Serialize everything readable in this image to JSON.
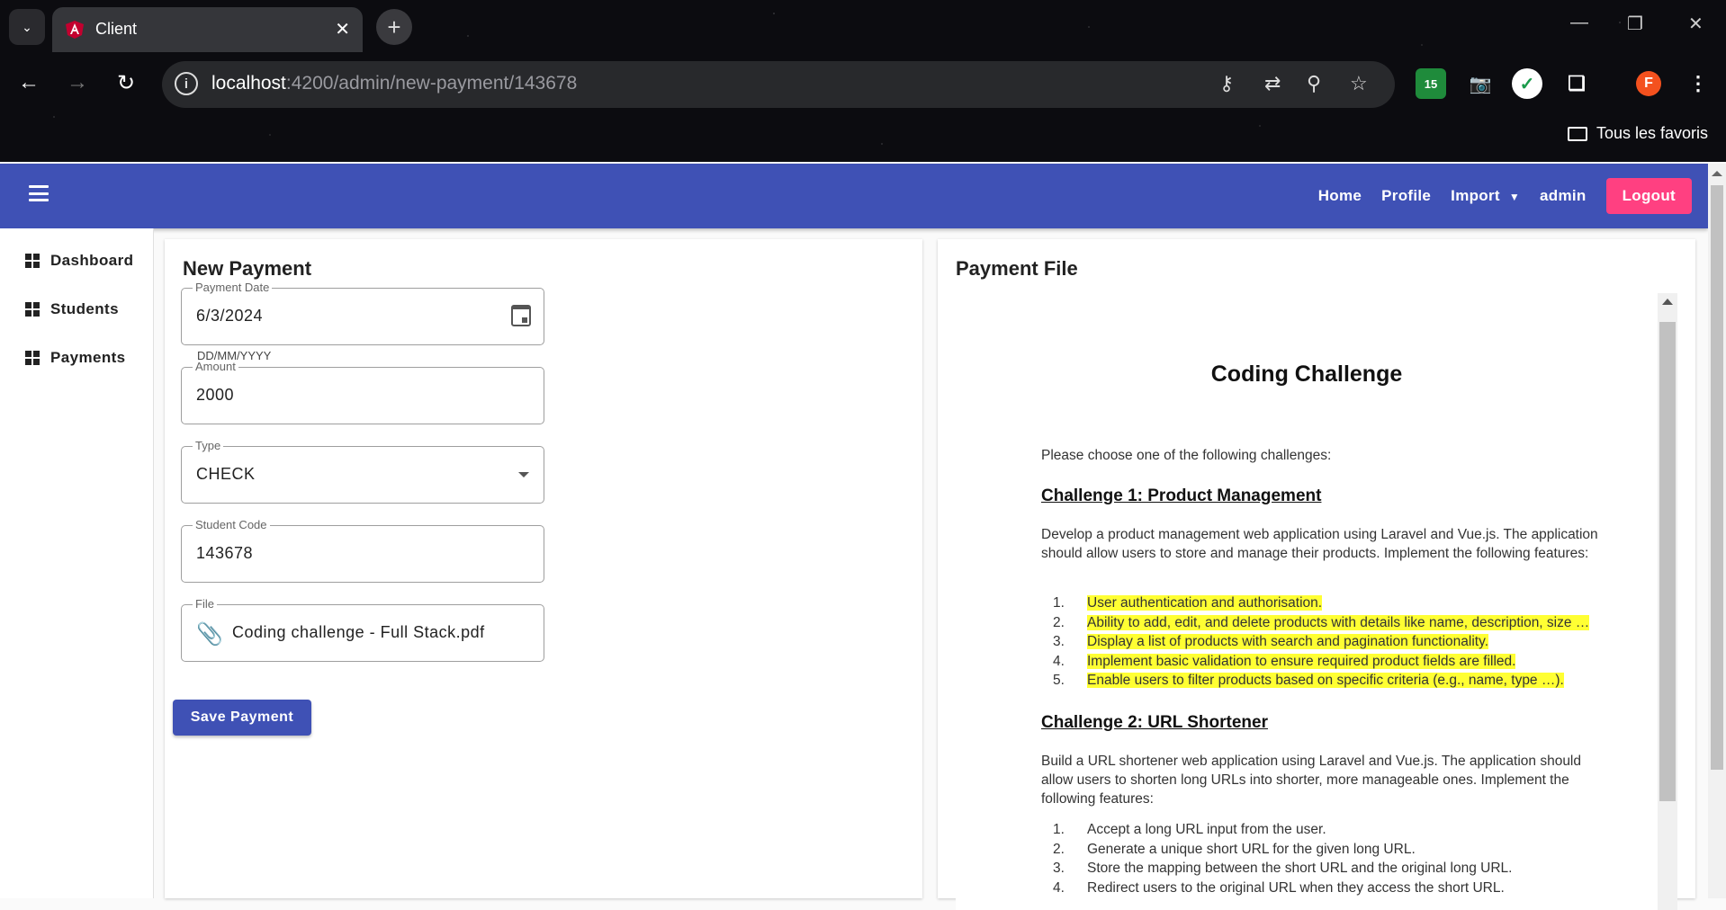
{
  "browser": {
    "tab_title": "Client",
    "url_host": "localhost",
    "url_path": ":4200/admin/new-payment/143678",
    "bookmarks_label": "Tous les favoris",
    "profile_initial": "F",
    "extension_badge": "15"
  },
  "app": {
    "nav": {
      "home": "Home",
      "profile": "Profile",
      "import": "Import",
      "user": "admin",
      "logout": "Logout"
    },
    "sidebar": [
      {
        "label": "Dashboard"
      },
      {
        "label": "Students"
      },
      {
        "label": "Payments"
      }
    ]
  },
  "form": {
    "title": "New Payment",
    "payment_date_label": "Payment Date",
    "payment_date_value": "6/3/2024",
    "payment_date_hint": "DD/MM/YYYY",
    "amount_label": "Amount",
    "amount_value": "2000",
    "type_label": "Type",
    "type_value": "CHECK",
    "student_code_label": "Student Code",
    "student_code_value": "143678",
    "file_label": "File",
    "file_value": "Coding challenge - Full Stack.pdf",
    "save_label": "Save Payment"
  },
  "payment_file": {
    "title": "Payment File",
    "doc": {
      "title": "Coding Challenge",
      "intro": "Please choose one of the following challenges:",
      "c1_heading": "Challenge 1: Product Management",
      "c1_desc": "Develop a product management web application using Laravel and Vue.js. The application should allow users to store and manage their products. Implement the following features:",
      "c1_items": [
        "User authentication and authorisation.",
        "Ability to add, edit, and delete products with details like name, description, size …",
        "Display a list of products with search and pagination functionality.",
        "Implement basic validation to ensure required product fields are filled.",
        "Enable users to filter products based on specific criteria (e.g., name, type …)."
      ],
      "c2_heading": "Challenge 2: URL Shortener",
      "c2_desc": "Build a URL shortener web application using Laravel and Vue.js. The application should allow users to shorten long URLs into shorter, more manageable ones. Implement the following features:",
      "c2_items": [
        "Accept a long URL input from the user.",
        "Generate a unique short URL for the given long URL.",
        "Store the mapping between the short URL and the original long URL.",
        "Redirect users to the original URL when they access the short URL."
      ]
    }
  },
  "colors": {
    "primary": "#3f51b5",
    "accent": "#ff4081",
    "highlight": "#ffff33"
  }
}
